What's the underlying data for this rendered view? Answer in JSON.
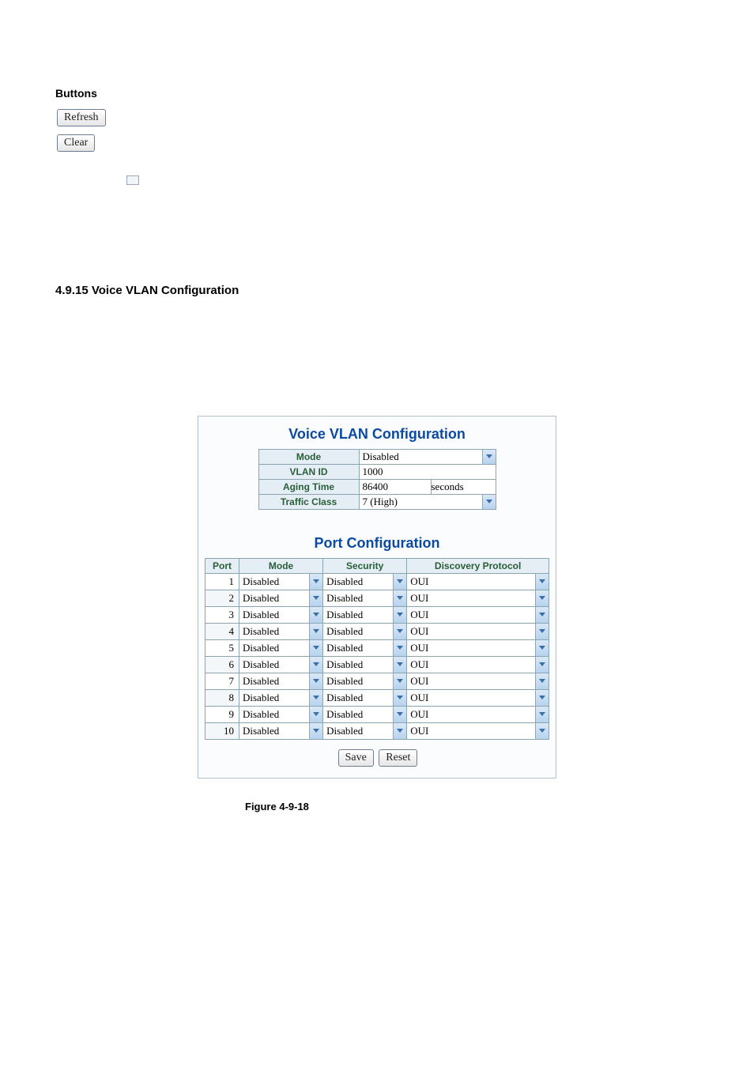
{
  "buttons_heading": "Buttons",
  "btn_refresh": "Refresh",
  "btn_clear": "Clear",
  "section_heading": "4.9.15 Voice VLAN Configuration",
  "voice_title": "Voice VLAN Configuration",
  "voice_labels": {
    "mode": "Mode",
    "vlan_id": "VLAN ID",
    "aging_time": "Aging Time",
    "traffic_class": "Traffic Class"
  },
  "voice_values": {
    "mode": "Disabled",
    "vlan_id": "1000",
    "aging_time": "86400",
    "aging_unit": "seconds",
    "traffic_class": "7 (High)"
  },
  "port_title": "Port Configuration",
  "port_headers": {
    "port": "Port",
    "mode": "Mode",
    "security": "Security",
    "discovery": "Discovery Protocol"
  },
  "ports": [
    {
      "n": "1",
      "mode": "Disabled",
      "security": "Disabled",
      "discovery": "OUI"
    },
    {
      "n": "2",
      "mode": "Disabled",
      "security": "Disabled",
      "discovery": "OUI"
    },
    {
      "n": "3",
      "mode": "Disabled",
      "security": "Disabled",
      "discovery": "OUI"
    },
    {
      "n": "4",
      "mode": "Disabled",
      "security": "Disabled",
      "discovery": "OUI"
    },
    {
      "n": "5",
      "mode": "Disabled",
      "security": "Disabled",
      "discovery": "OUI"
    },
    {
      "n": "6",
      "mode": "Disabled",
      "security": "Disabled",
      "discovery": "OUI"
    },
    {
      "n": "7",
      "mode": "Disabled",
      "security": "Disabled",
      "discovery": "OUI"
    },
    {
      "n": "8",
      "mode": "Disabled",
      "security": "Disabled",
      "discovery": "OUI"
    },
    {
      "n": "9",
      "mode": "Disabled",
      "security": "Disabled",
      "discovery": "OUI"
    },
    {
      "n": "10",
      "mode": "Disabled",
      "security": "Disabled",
      "discovery": "OUI"
    }
  ],
  "btn_save": "Save",
  "btn_reset": "Reset",
  "figure_caption": "Figure 4-9-18"
}
